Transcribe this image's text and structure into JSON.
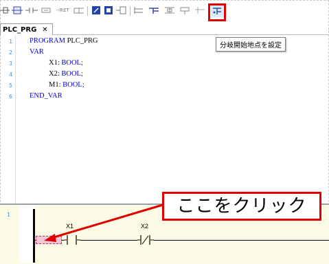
{
  "editor_tab": {
    "title": "PLC_PRG",
    "close_glyph": "✕"
  },
  "toolbar": {
    "icons": [
      "network-insert-icon",
      "network-append-icon",
      "contact-icon",
      "coil-icon",
      "reset-coil-icon",
      "parallel-contact-icon",
      "box-icon",
      "box-enable-icon",
      "jump-icon",
      "return-icon",
      "branch-icon",
      "branch-up-icon",
      "branch-down-icon",
      "set-branch-start-icon"
    ],
    "text_glyphs": {
      "ret": "⊣RET"
    },
    "highlight_color": "#e00000"
  },
  "tooltip": {
    "text": "分岐開始地点を設定"
  },
  "code": {
    "line_numbers": [
      "1",
      "2",
      "3",
      "4",
      "5",
      "6"
    ],
    "lines": [
      {
        "kw": "PROGRAM",
        "rest": " PLC_PRG"
      },
      {
        "kw": "VAR",
        "rest": ""
      },
      {
        "name": "X1:",
        "type": " BOOL;"
      },
      {
        "name": "X2:",
        "type": " BOOL;"
      },
      {
        "name": "M1:",
        "type": " BOOL;"
      },
      {
        "kw": "END_VAR",
        "rest": ""
      }
    ]
  },
  "ladder": {
    "network_number": "1",
    "contacts": [
      {
        "label": "X1",
        "kind": "normally-open"
      },
      {
        "label": "X2",
        "kind": "normally-closed"
      }
    ]
  },
  "annotation": {
    "text": "ここをクリック",
    "color": "#e00000"
  }
}
